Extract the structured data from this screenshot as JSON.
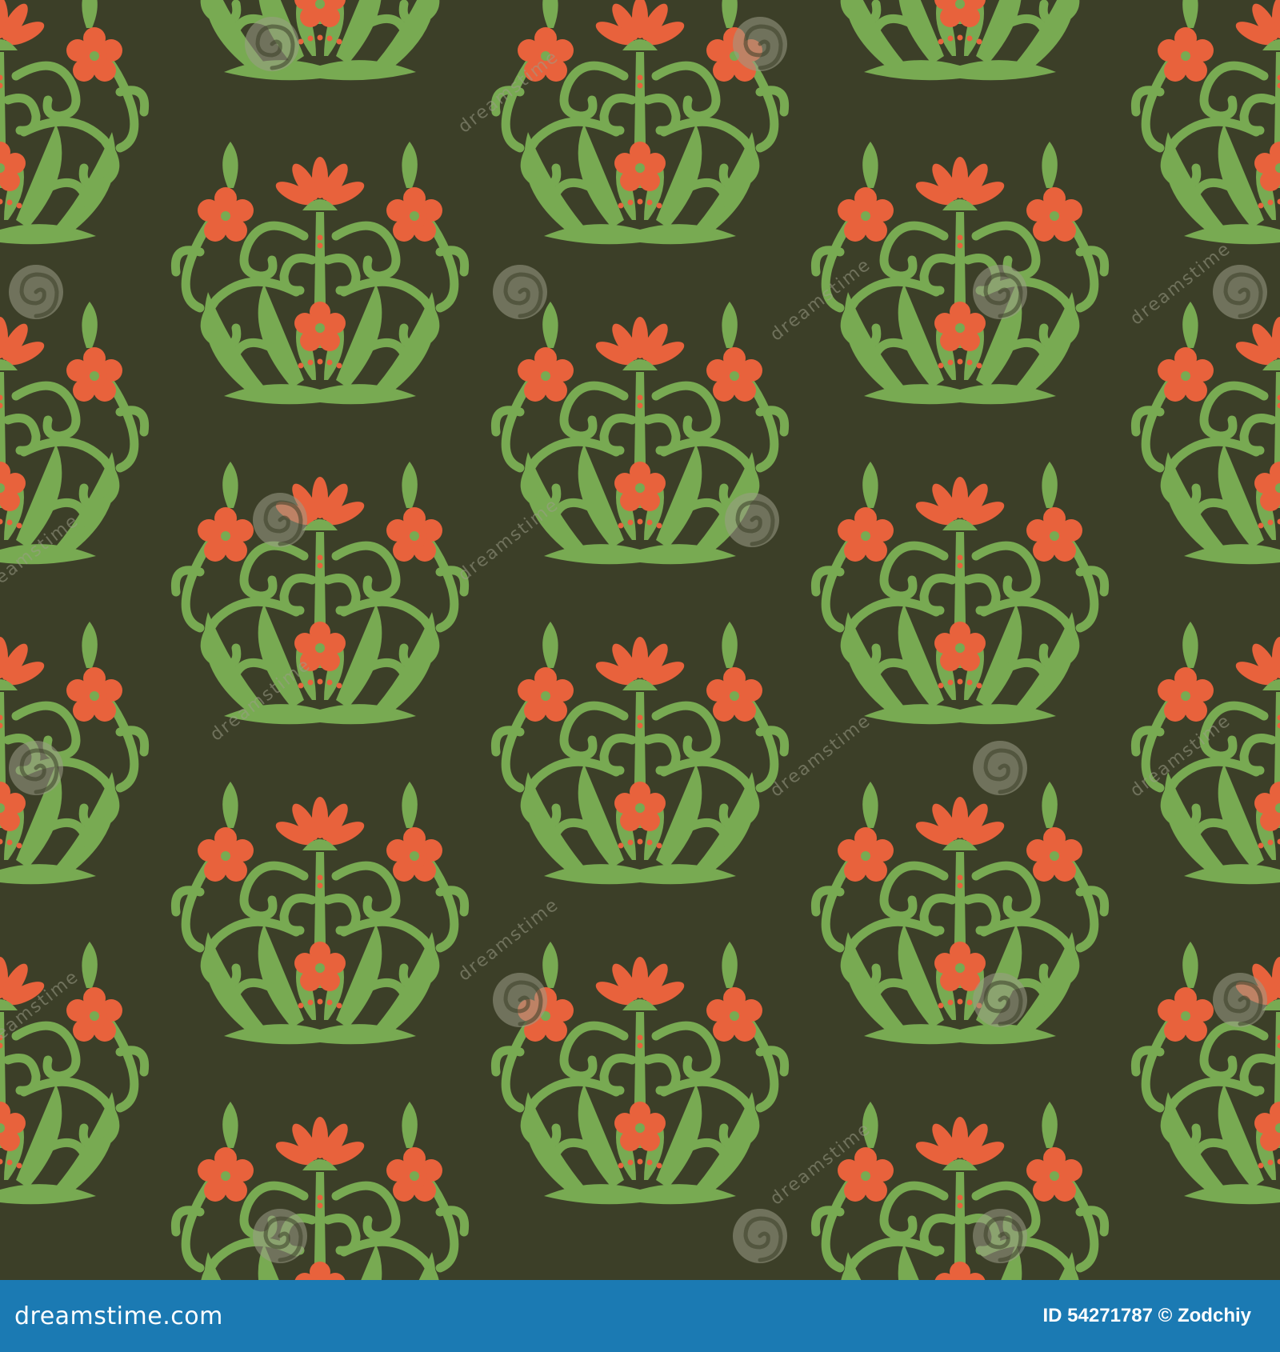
{
  "image": {
    "background_color": "#3c3f28",
    "leaf_color": "#78aa52",
    "flower_color": "#e8623c",
    "watermark": {
      "text": "dreamstime",
      "icon": "spiral-icon"
    }
  },
  "footer": {
    "background_color": "#1b7ab3",
    "logo_text": "dreamstime.com",
    "id_label": "ID",
    "id_value": "54271787",
    "copyright_symbol": "©",
    "author": "Zodchiy"
  }
}
